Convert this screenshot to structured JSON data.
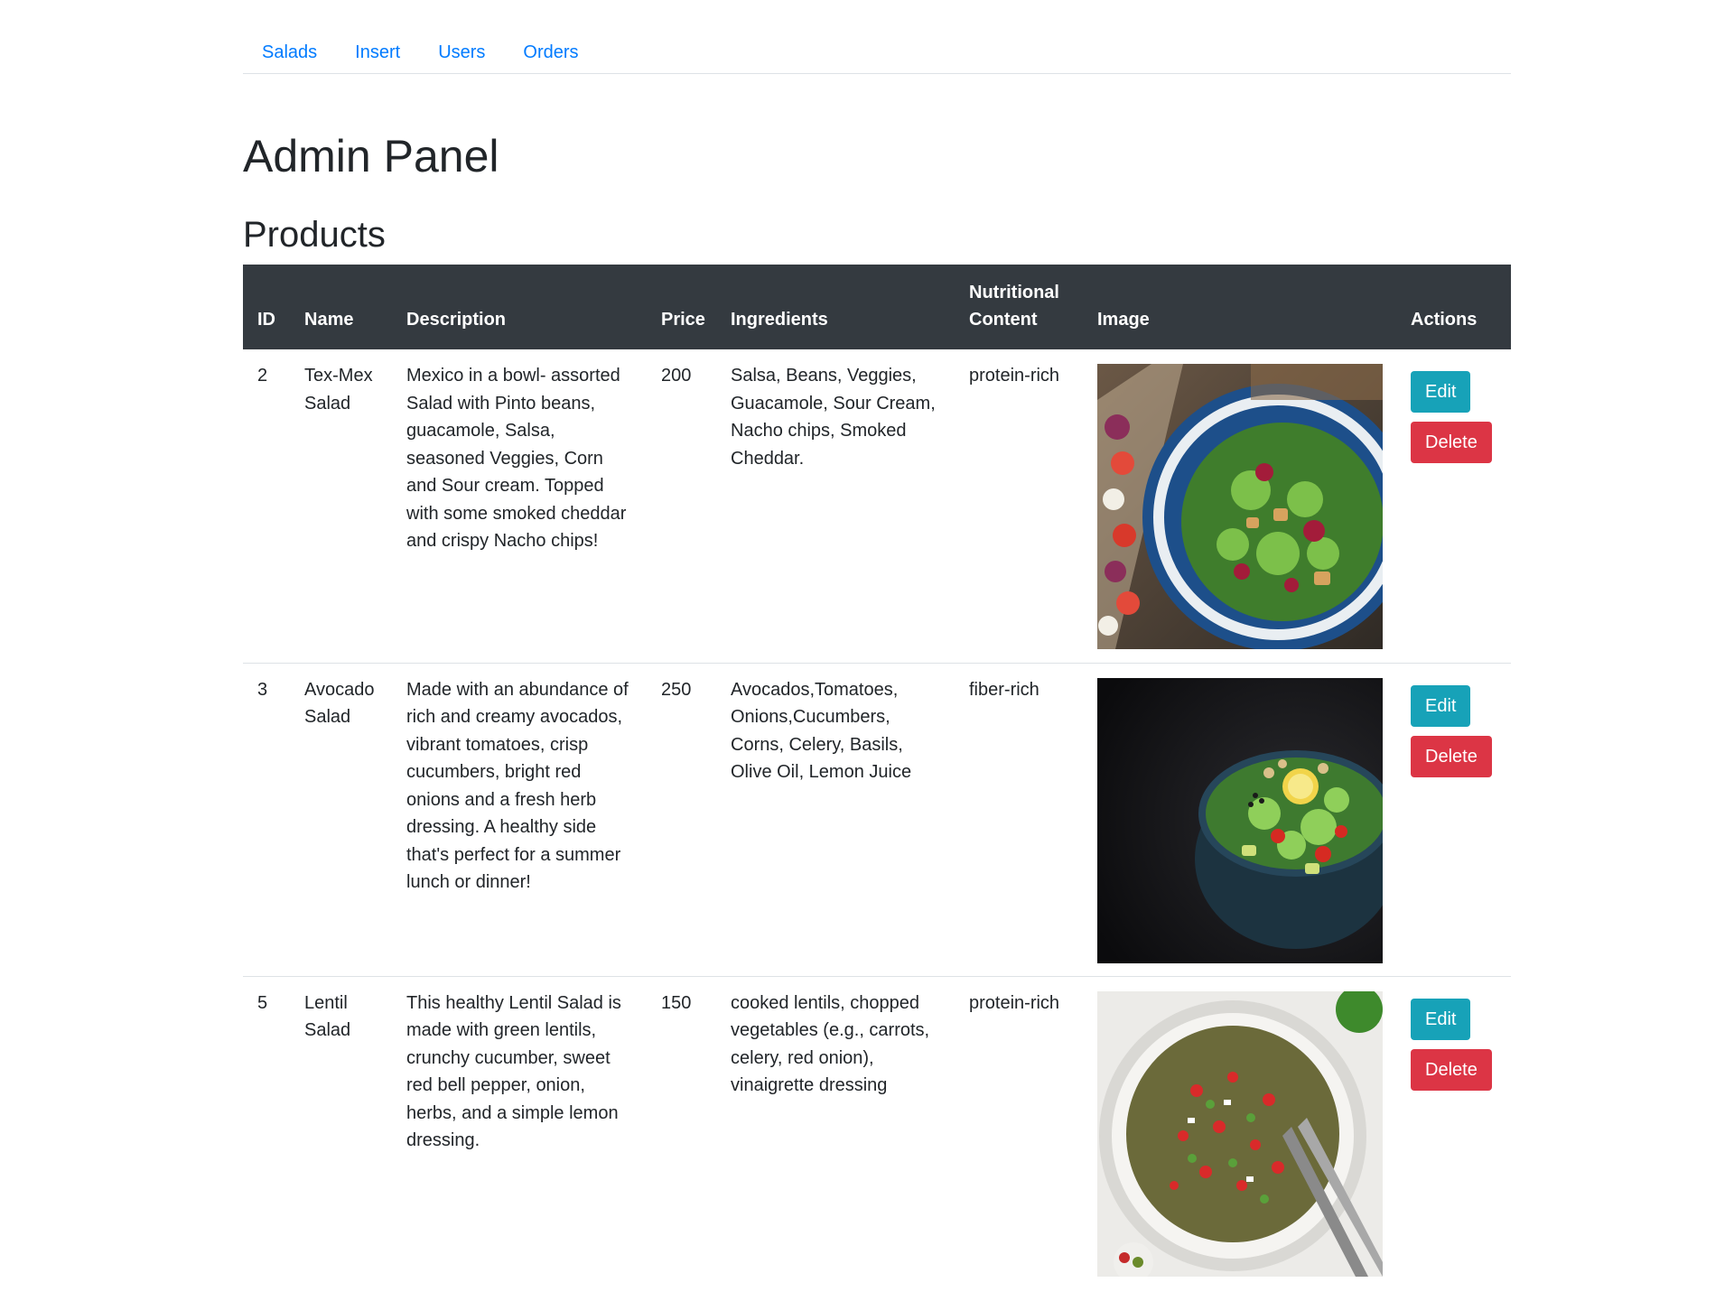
{
  "nav": {
    "items": [
      {
        "label": "Salads"
      },
      {
        "label": "Insert"
      },
      {
        "label": "Users"
      },
      {
        "label": "Orders"
      }
    ]
  },
  "page": {
    "title": "Admin Panel",
    "section_title": "Products"
  },
  "table": {
    "headers": {
      "id": "ID",
      "name": "Name",
      "description": "Description",
      "price": "Price",
      "ingredients": "Ingredients",
      "nutritional": "Nutritional Content",
      "image": "Image",
      "actions": "Actions"
    },
    "rows": [
      {
        "id": "2",
        "name": "Tex-Mex Salad",
        "description": "Mexico in a bowl- assorted Salad with Pinto beans, guacamole, Salsa, seasoned Veggies, Corn and Sour cream. Topped with some smoked cheddar and crispy Nacho chips!",
        "price": "200",
        "ingredients": "Salsa, Beans, Veggies, Guacamole, Sour Cream, Nacho chips, Smoked Cheddar.",
        "nutritional": "protein-rich",
        "edit_label": "Edit",
        "delete_label": "Delete"
      },
      {
        "id": "3",
        "name": "Avocado Salad",
        "description": "Made with an abundance of rich and creamy avocados, vibrant tomatoes, crisp cucumbers, bright red onions and a fresh herb dressing. A healthy side that's perfect for a summer lunch or dinner!",
        "price": "250",
        "ingredients": "Avocados,Tomatoes, Onions,Cucumbers, Corns, Celery, Basils, Olive Oil, Lemon Juice",
        "nutritional": "fiber-rich",
        "edit_label": "Edit",
        "delete_label": "Delete"
      },
      {
        "id": "5",
        "name": "Lentil Salad",
        "description": "This healthy Lentil Salad is made with green lentils, crunchy cucumber, sweet red bell pepper, onion, herbs, and a simple lemon dressing.",
        "price": "150",
        "ingredients": "cooked lentils, chopped vegetables (e.g., carrots, celery, red onion), vinaigrette dressing",
        "nutritional": "protein-rich",
        "edit_label": "Edit",
        "delete_label": "Delete"
      }
    ]
  },
  "colors": {
    "link": "#007bff",
    "header_bg": "#343a40",
    "edit_button": "#17a2b8",
    "delete_button": "#dc3545"
  }
}
